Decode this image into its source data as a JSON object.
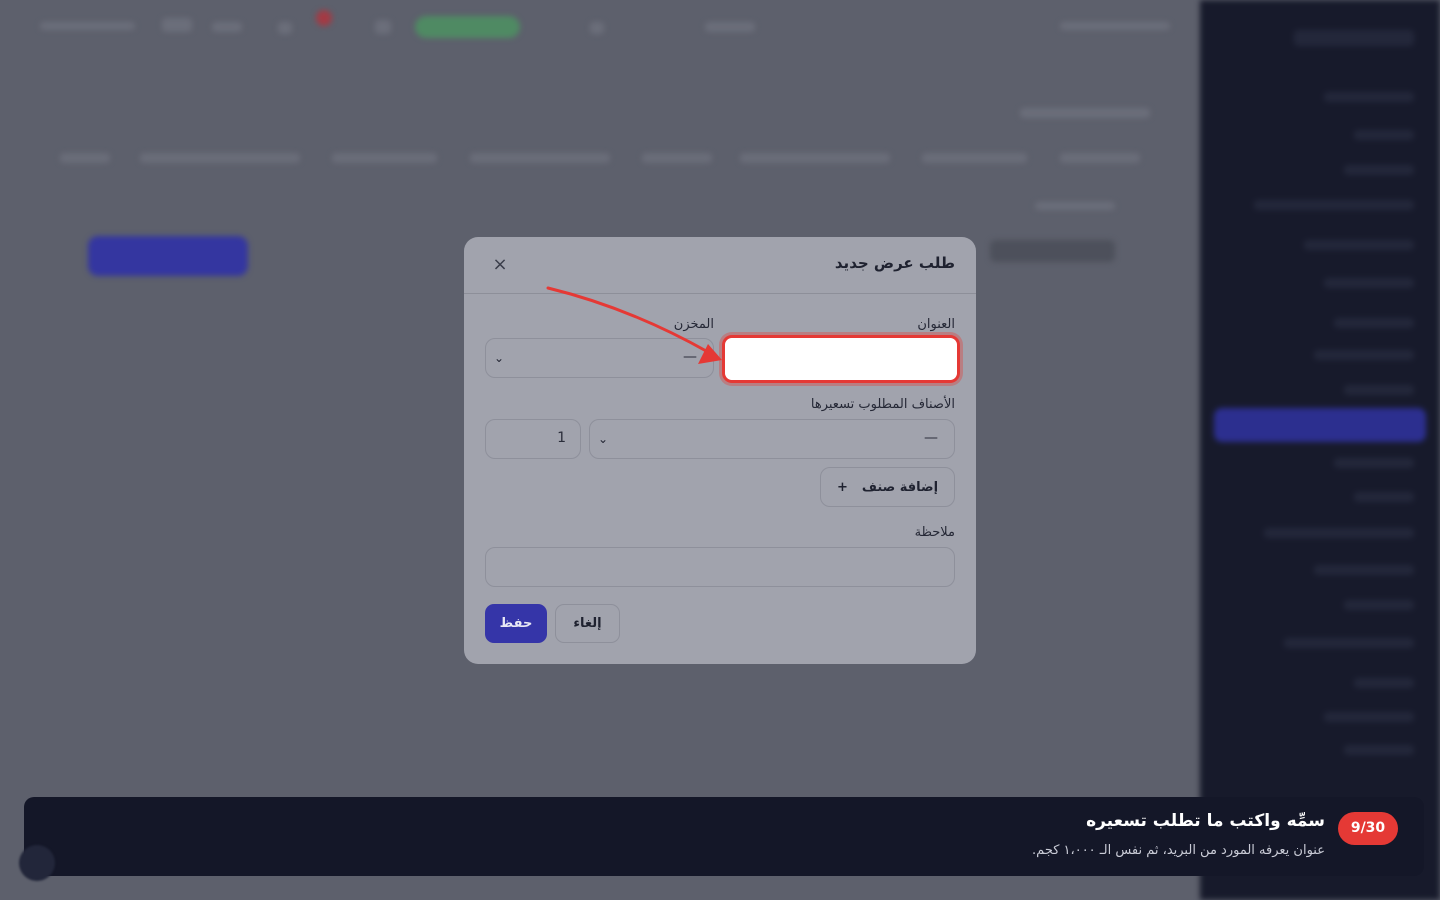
{
  "modal": {
    "title": "طلب عرض جديد",
    "close_icon": "×",
    "title_label": "العنوان",
    "title_value": "",
    "warehouse_label": "المخزن",
    "warehouse_value": "—",
    "items_label": "الأصناف المطلوب تسعيرها",
    "item_value": "—",
    "qty_value": "1",
    "add_item_label": "إضافة صنف",
    "add_icon": "+",
    "note_label": "ملاحظة",
    "note_value": "",
    "cancel_label": "إلغاء",
    "save_label": "حفظ"
  },
  "guide": {
    "step": "9/30",
    "title": "سمِّه واكتب ما تطلب تسعيره",
    "description": "عنوان يعرفه المورد من البريد، ثم نفس الـ ١،٠٠٠ كجم."
  },
  "colors": {
    "accent": "#3535a8",
    "highlight": "#e53935",
    "guide_bg": "#141728"
  }
}
